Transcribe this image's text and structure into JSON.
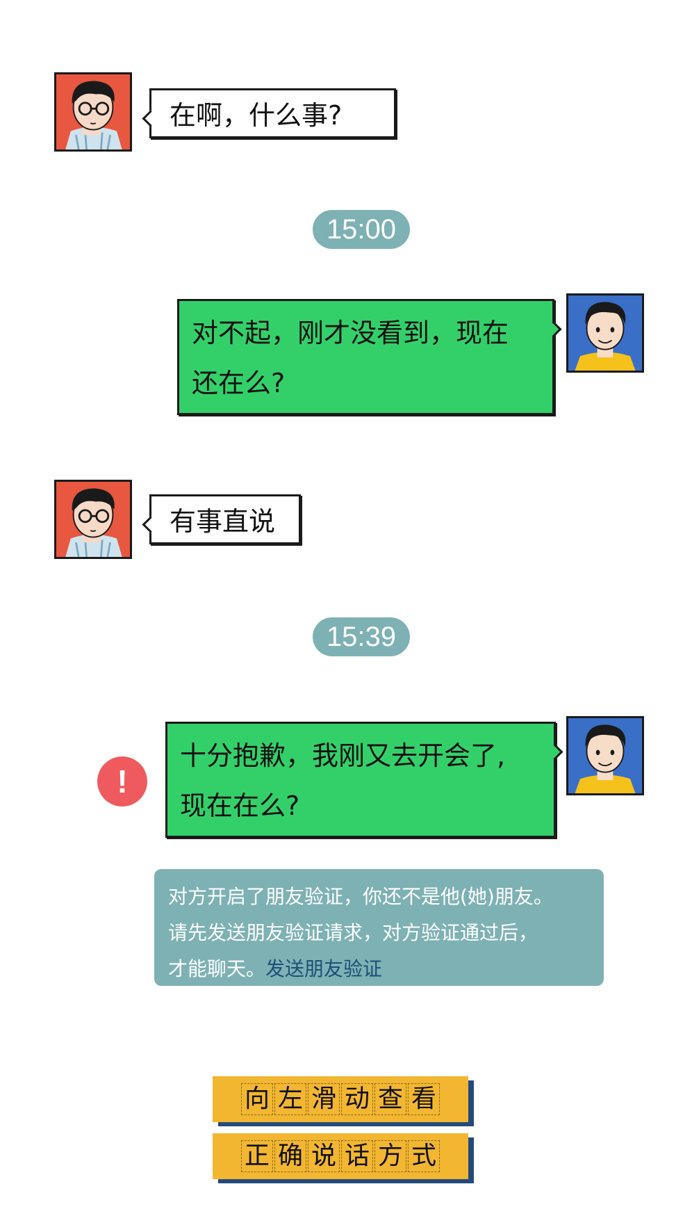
{
  "messages": [
    {
      "side": "left",
      "text": "在啊，什么事?"
    },
    {
      "side": "right",
      "line1": "对不起，刚才没看到，现在",
      "line2": "还在么?"
    },
    {
      "side": "left",
      "text": "有事直说"
    },
    {
      "side": "right",
      "line1": "十分抱歉，我刚又去开会了,",
      "line2": "现在在么?",
      "status": "failed"
    }
  ],
  "timestamps": [
    "15:00",
    "15:39"
  ],
  "notice": {
    "line1": "对方开启了朋友验证，你还不是他(她)朋友。",
    "line2": "请先发送朋友验证请求，对方验证通过后，",
    "line3_prefix": "才能聊天。",
    "link": "发送朋友验证"
  },
  "cta": {
    "line1": [
      "向",
      "左",
      "滑",
      "动",
      "查",
      "看"
    ],
    "line2": [
      "正",
      "确",
      "说",
      "话",
      "方",
      "式"
    ]
  },
  "icons": {
    "left_avatar": "glasses-man-avatar-icon",
    "right_avatar": "smiling-man-avatar-icon",
    "alert": "exclamation-alert-icon"
  },
  "colors": {
    "green_bubble": "#33d06a",
    "time_pill": "#7eb1b3",
    "alert": "#ef5a5f",
    "cta": "#f2b631",
    "cta_shadow": "#244a7b",
    "link": "#1d4f79"
  }
}
